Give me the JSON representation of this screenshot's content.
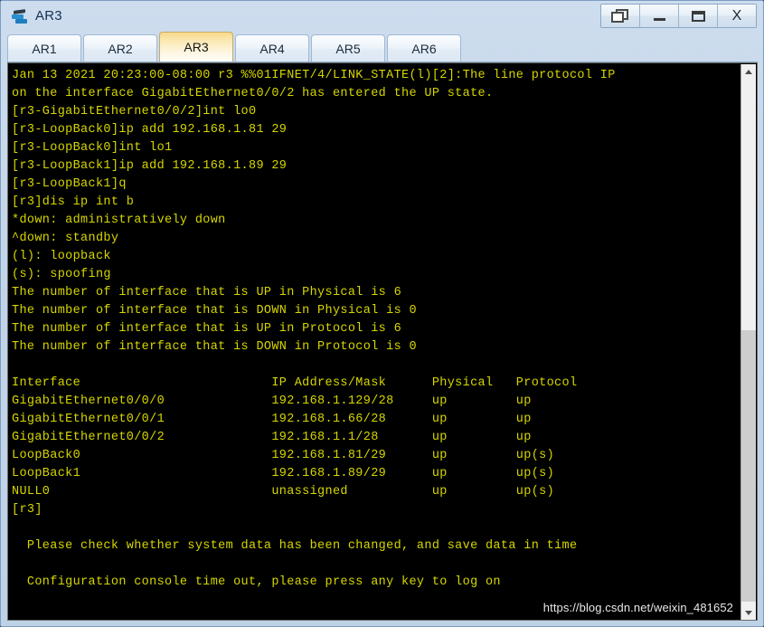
{
  "window": {
    "title": "AR3",
    "icon": "router-icon",
    "controls": [
      {
        "name": "restore-window-button",
        "glyph": "restore"
      },
      {
        "name": "minimize-window-button",
        "glyph": "minimize"
      },
      {
        "name": "maximize-window-button",
        "glyph": "maximize"
      },
      {
        "name": "close-window-button",
        "glyph": "X"
      }
    ]
  },
  "tabs": [
    {
      "label": "AR1",
      "active": false
    },
    {
      "label": "AR2",
      "active": false
    },
    {
      "label": "AR3",
      "active": true
    },
    {
      "label": "AR4",
      "active": false
    },
    {
      "label": "AR5",
      "active": false
    },
    {
      "label": "AR6",
      "active": false
    }
  ],
  "terminal": {
    "foreground": "#d6d600",
    "background": "#000000",
    "lines": [
      "Jan 13 2021 20:23:00-08:00 r3 %%01IFNET/4/LINK_STATE(l)[2]:The line protocol IP",
      "on the interface GigabitEthernet0/0/2 has entered the UP state.",
      "[r3-GigabitEthernet0/0/2]int lo0",
      "[r3-LoopBack0]ip add 192.168.1.81 29",
      "[r3-LoopBack0]int lo1",
      "[r3-LoopBack1]ip add 192.168.1.89 29",
      "[r3-LoopBack1]q",
      "[r3]dis ip int b",
      "*down: administratively down",
      "^down: standby",
      "(l): loopback",
      "(s): spoofing",
      "The number of interface that is UP in Physical is 6",
      "The number of interface that is DOWN in Physical is 0",
      "The number of interface that is UP in Protocol is 6",
      "The number of interface that is DOWN in Protocol is 0",
      "",
      "Interface                         IP Address/Mask      Physical   Protocol",
      "GigabitEthernet0/0/0              192.168.1.129/28     up         up",
      "GigabitEthernet0/0/1              192.168.1.66/28      up         up",
      "GigabitEthernet0/0/2              192.168.1.1/28       up         up",
      "LoopBack0                         192.168.1.81/29      up         up(s)",
      "LoopBack1                         192.168.1.89/29      up         up(s)",
      "NULL0                             unassigned           up         up(s)",
      "[r3]",
      "",
      "  Please check whether system data has been changed, and save data in time",
      "",
      "  Configuration console time out, please press any key to log on"
    ],
    "interface_table": {
      "headers": [
        "Interface",
        "IP Address/Mask",
        "Physical",
        "Protocol"
      ],
      "rows": [
        [
          "GigabitEthernet0/0/0",
          "192.168.1.129/28",
          "up",
          "up"
        ],
        [
          "GigabitEthernet0/0/1",
          "192.168.1.66/28",
          "up",
          "up"
        ],
        [
          "GigabitEthernet0/0/2",
          "192.168.1.1/28",
          "up",
          "up"
        ],
        [
          "LoopBack0",
          "192.168.1.81/29",
          "up",
          "up(s)"
        ],
        [
          "LoopBack1",
          "192.168.1.89/29",
          "up",
          "up(s)"
        ],
        [
          "NULL0",
          "unassigned",
          "up",
          "up(s)"
        ]
      ]
    },
    "counters": {
      "up_physical": "6",
      "down_physical": "0",
      "up_protocol": "6",
      "down_protocol": "0"
    },
    "prompt": "[r3]"
  },
  "scrollbar": {
    "up_arrow": "chevron-up-icon",
    "down_arrow": "chevron-down-icon"
  },
  "watermark": {
    "text": "https://blog.csdn.net/weixin_481652"
  }
}
